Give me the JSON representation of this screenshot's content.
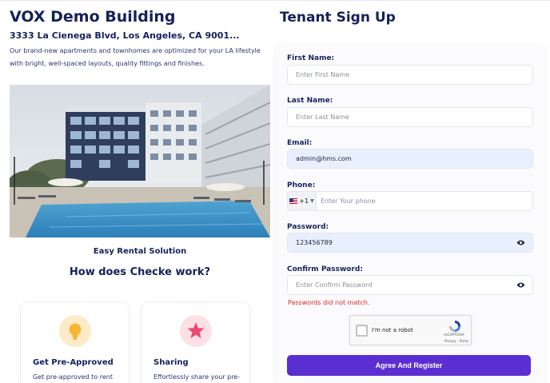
{
  "building": {
    "title": "VOX Demo Building",
    "address": "3333 La Cienega Blvd, Los Angeles, CA 9001...",
    "description": "Our brand-new apartments and townhomes are optimized for your LA lifestyle with bright, well-spaced layouts, quality fittings and finishes.",
    "tagline": "Easy Rental Solution",
    "how_heading": "How does Checke work?"
  },
  "features": [
    {
      "title": "Get Pre-Approved",
      "text": "Get pre-approved to rent",
      "icon": "lightbulb-icon",
      "color": "#f7b733"
    },
    {
      "title": "Sharing",
      "text": "Effortlessly share your pre-",
      "icon": "star-icon",
      "color": "#ef476f"
    }
  ],
  "form": {
    "title": "Tenant Sign Up",
    "first_name": {
      "label": "First Name:",
      "placeholder": "Enter First Name",
      "value": ""
    },
    "last_name": {
      "label": "Last Name:",
      "placeholder": "Enter Last Name",
      "value": ""
    },
    "email": {
      "label": "Email:",
      "value": "admin@hms.com"
    },
    "phone": {
      "label": "Phone:",
      "country_code": "+1",
      "placeholder": "Enter Your phone"
    },
    "password": {
      "label": "Password:",
      "value": "123456789"
    },
    "confirm_password": {
      "label": "Confirm Password:",
      "placeholder": "Enter Confirm Password"
    },
    "error": "Passwords did not match.",
    "captcha": {
      "label": "I'm not a robot",
      "brand": "reCAPTCHA",
      "links": "Privacy - Terms"
    },
    "submit_label": "Agree And Register"
  },
  "colors": {
    "accent": "#5b2ed1",
    "heading": "#16215a",
    "error": "#d62828",
    "autofill": "#e8f0fe"
  }
}
